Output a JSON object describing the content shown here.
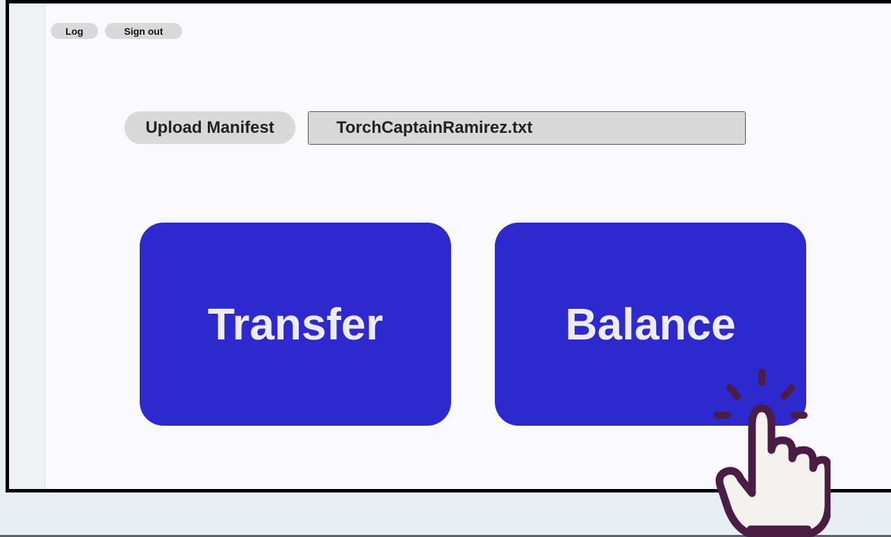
{
  "toolbar": {
    "log_label": "Log",
    "signout_label": "Sign out"
  },
  "upload": {
    "button_label": "Upload Manifest",
    "file_name": "TorchCaptainRamirez.txt"
  },
  "actions": {
    "transfer_label": "Transfer",
    "balance_label": "Balance"
  },
  "colors": {
    "action_button": "#2e28cf",
    "action_text": "#ecebf7",
    "pill_bg": "#d9d9d9",
    "cursor_outline": "#4a1d45"
  },
  "icons": {
    "cursor": "hand-pointer-click-icon"
  }
}
